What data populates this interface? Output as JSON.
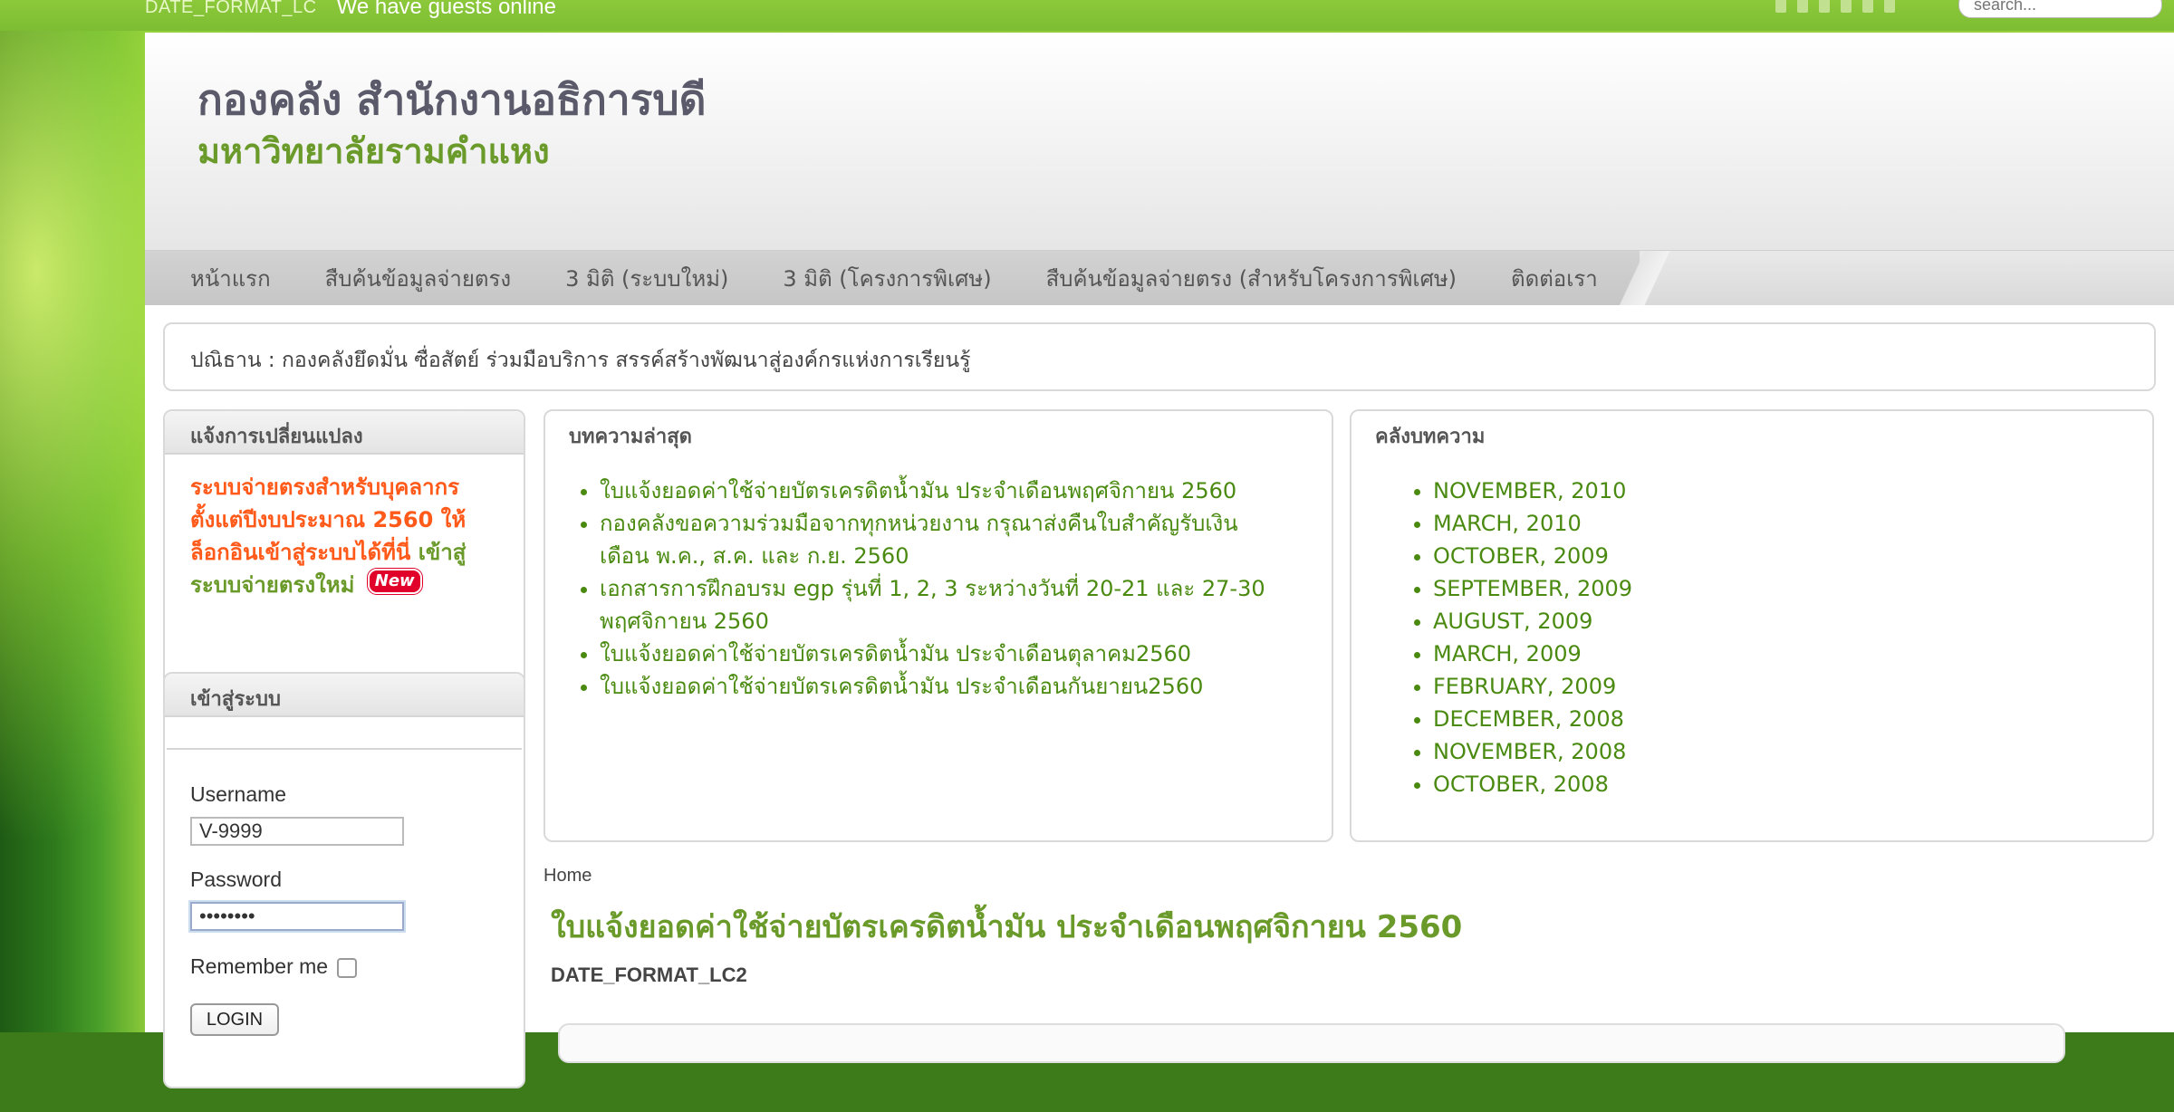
{
  "topbar": {
    "date_format": "DATE_FORMAT_LC",
    "guests": "We have guests online",
    "search_placeholder": "search..."
  },
  "header": {
    "title": "กองคลัง สำนักงานอธิการบดี",
    "subtitle": "มหาวิทยาลัยรามคำแหง"
  },
  "nav": {
    "items": [
      {
        "label": "หน้าแรก"
      },
      {
        "label": "สืบค้นข้อมูลจ่ายตรง"
      },
      {
        "label": "3 มิติ (ระบบใหม่)"
      },
      {
        "label": "3 มิติ (โครงการพิเศษ)"
      },
      {
        "label": "สืบค้นข้อมูลจ่ายตรง (สำหรับโครงการพิเศษ)"
      },
      {
        "label": "ติดต่อเรา"
      }
    ]
  },
  "motto": "ปณิธาน : กองคลังยึดมั่น ซื่อสัตย์ ร่วมมือบริการ สรรค์สร้างพัฒนาสู่องค์กรแห่งการเรียนรู้",
  "announce": {
    "title": "แจ้งการเปลี่ยนแปลง",
    "text": "ระบบจ่ายตรงสำหรับบุคลากร ตั้งแต่ปีงบประมาณ 2560 ให้ล็อกอินเข้าสู่ระบบได้ที่นี่",
    "link": "เข้าสู่ระบบจ่ายตรงใหม่",
    "badge": "New"
  },
  "login": {
    "title": "เข้าสู่ระบบ",
    "username_label": "Username",
    "username_value": "V-9999",
    "password_label": "Password",
    "password_value": "••••••••",
    "remember_label": "Remember me",
    "button": "LOGIN"
  },
  "latest": {
    "title": "บทความล่าสุด",
    "items": [
      "ใบแจ้งยอดค่าใช้จ่ายบัตรเครดิตน้ำมัน ประจำเดือนพฤศจิกายน 2560",
      "กองคลังขอความร่วมมือจากทุกหน่วยงาน กรุณาส่งคืนใบสำคัญรับเงิน เดือน พ.ค., ส.ค. และ ก.ย. 2560",
      "เอกสารการฝึกอบรม egp รุ่นที่ 1, 2, 3 ระหว่างวันที่ 20-21 และ 27-30 พฤศจิกายน 2560",
      "ใบแจ้งยอดค่าใช้จ่ายบัตรเครดิตน้ำมัน ประจำเดือนตุลาคม2560",
      "ใบแจ้งยอดค่าใช้จ่ายบัตรเครดิตน้ำมัน ประจำเดือนกันยายน2560"
    ]
  },
  "archive": {
    "title": "คลังบทความ",
    "items": [
      "NOVEMBER, 2010",
      "MARCH, 2010",
      "OCTOBER, 2009",
      "SEPTEMBER, 2009",
      "AUGUST, 2009",
      "MARCH, 2009",
      "FEBRUARY, 2009",
      "DECEMBER, 2008",
      "NOVEMBER, 2008",
      "OCTOBER, 2008"
    ]
  },
  "article": {
    "breadcrumb": "Home",
    "title": "ใบแจ้งยอดค่าใช้จ่ายบัตรเครดิตน้ำมัน ประจำเดือนพฤศจิกายน 2560",
    "date": "DATE_FORMAT_LC2"
  }
}
